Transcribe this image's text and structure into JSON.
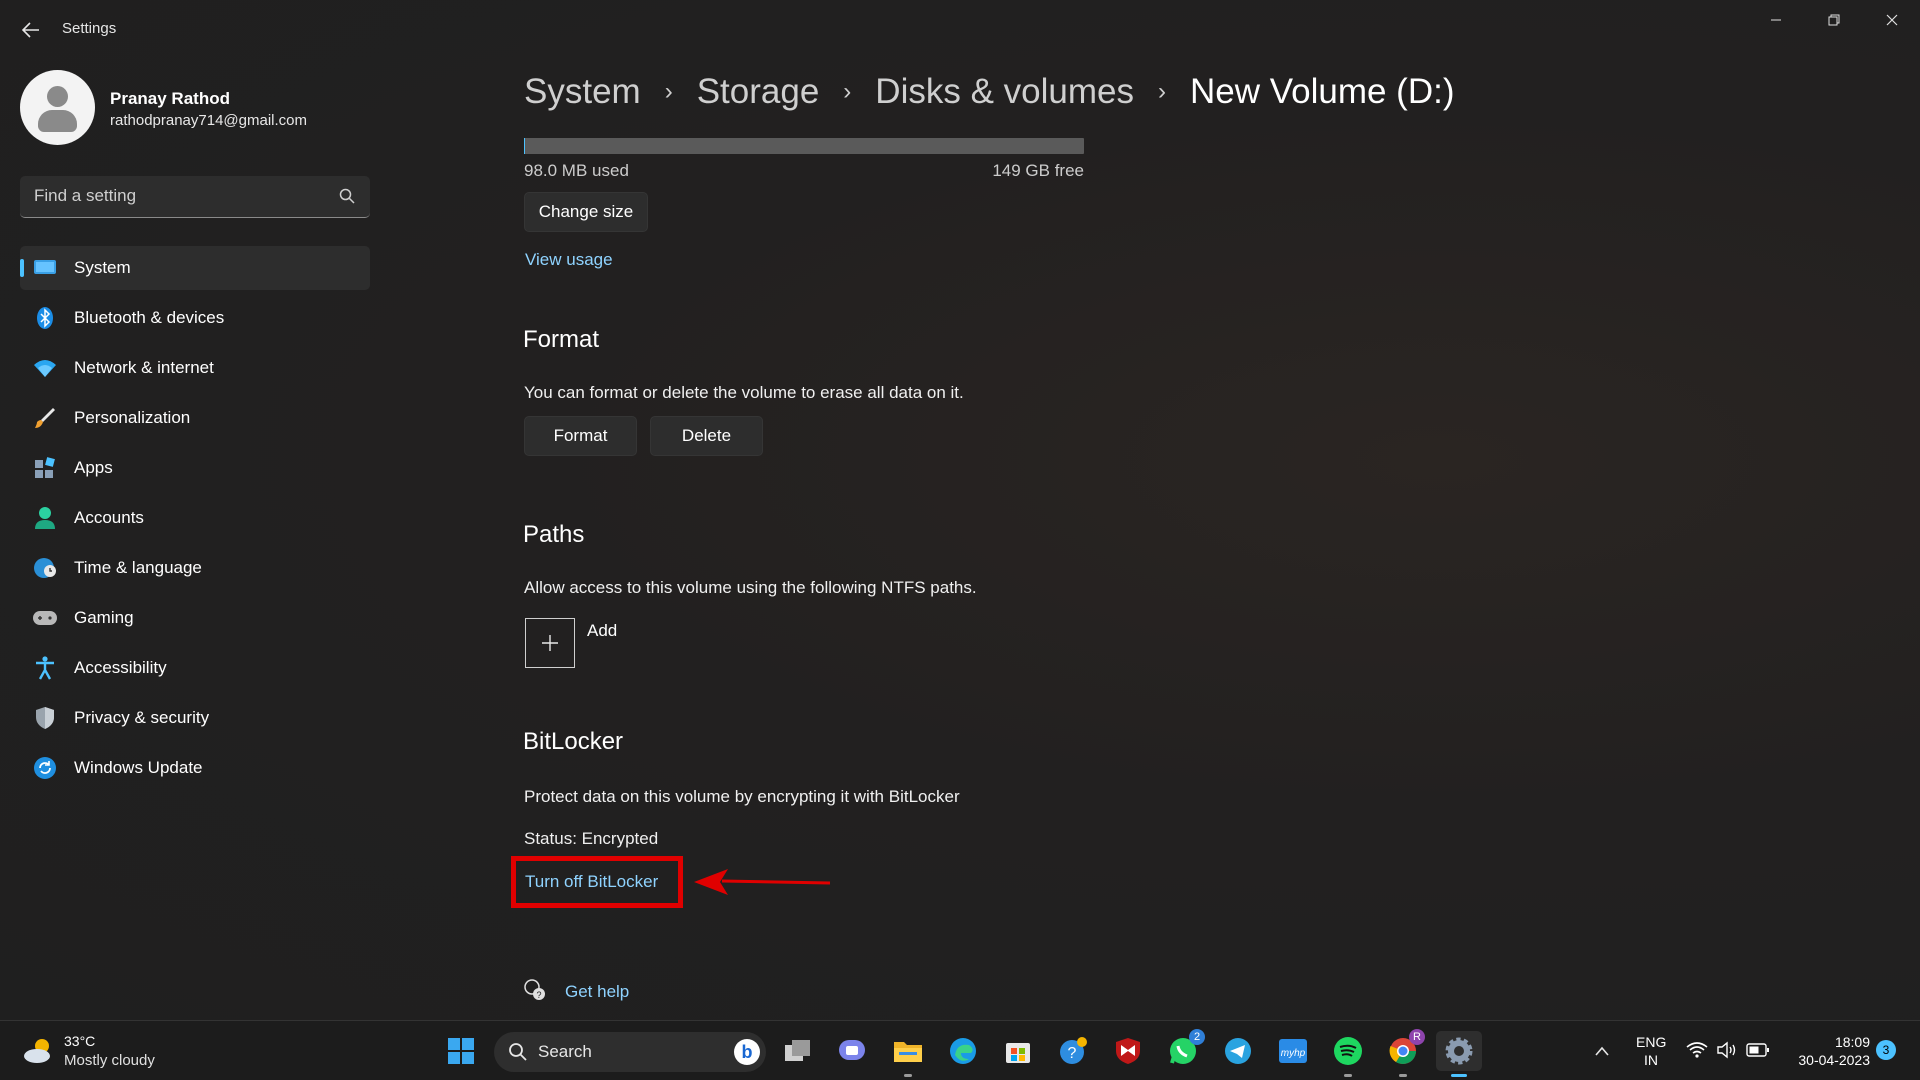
{
  "window": {
    "title": "Settings",
    "controls": [
      "minimize",
      "restore",
      "close"
    ]
  },
  "profile": {
    "name": "Pranay Rathod",
    "email": "rathodpranay714@gmail.com"
  },
  "search": {
    "placeholder": "Find a setting"
  },
  "nav": {
    "items": [
      {
        "label": "System",
        "icon": "monitor-icon",
        "active": true
      },
      {
        "label": "Bluetooth & devices",
        "icon": "bluetooth-icon"
      },
      {
        "label": "Network & internet",
        "icon": "wifi-icon"
      },
      {
        "label": "Personalization",
        "icon": "brush-icon"
      },
      {
        "label": "Apps",
        "icon": "apps-icon"
      },
      {
        "label": "Accounts",
        "icon": "person-icon"
      },
      {
        "label": "Time & language",
        "icon": "globe-clock-icon"
      },
      {
        "label": "Gaming",
        "icon": "gamepad-icon"
      },
      {
        "label": "Accessibility",
        "icon": "accessibility-icon"
      },
      {
        "label": "Privacy & security",
        "icon": "shield-icon"
      },
      {
        "label": "Windows Update",
        "icon": "update-icon"
      }
    ]
  },
  "breadcrumb": [
    "System",
    "Storage",
    "Disks & volumes",
    "New Volume (D:)"
  ],
  "storage": {
    "used": "98.0 MB used",
    "free": "149 GB free",
    "used_fraction": 0.0007,
    "change_size_label": "Change size",
    "view_usage_label": "View usage"
  },
  "format_section": {
    "title": "Format",
    "description": "You can format or delete the volume to erase all data on it.",
    "format_label": "Format",
    "delete_label": "Delete"
  },
  "paths_section": {
    "title": "Paths",
    "description": "Allow access to this volume using the following NTFS paths.",
    "add_label": "Add"
  },
  "bitlocker_section": {
    "title": "BitLocker",
    "description": "Protect data on this volume by encrypting it with BitLocker",
    "status": "Status: Encrypted",
    "turn_off_label": "Turn off BitLocker"
  },
  "help": {
    "label": "Get help"
  },
  "taskbar": {
    "weather_temp": "33°C",
    "weather_desc": "Mostly cloudy",
    "search_label": "Search",
    "whatsapp_badge": "2",
    "chrome_badge": "R",
    "lang_top": "ENG",
    "lang_bottom": "IN",
    "time": "18:09",
    "date": "30-04-2023",
    "notification_count": "3"
  },
  "colors": {
    "accent": "#4cc2ff",
    "link": "#8fd3ff",
    "highlight": "#e00000"
  }
}
